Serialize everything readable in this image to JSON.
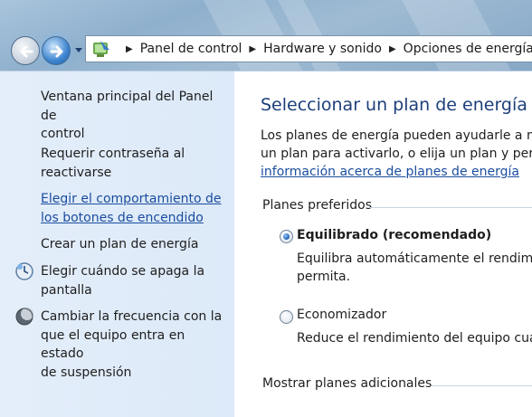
{
  "breadcrumb": [
    "Panel de control",
    "Hardware y sonido",
    "Opciones de energía"
  ],
  "icons": {
    "back": "back-arrow-icon",
    "forward": "forward-arrow-icon",
    "recent": "chevron-down-icon",
    "control_panel": "control-panel-icon",
    "display": "display-clock-icon",
    "sleep": "moon-sleep-icon"
  },
  "sidebar": {
    "items": [
      {
        "line1": "Ventana principal del Panel de",
        "line2": "control"
      },
      {
        "line1": "Requerir contraseña al",
        "line2": "reactivarse"
      },
      {
        "line1": "Elegir el comportamiento de",
        "line2": "los botones de encendido"
      },
      {
        "line1": "Crear un plan de energía"
      },
      {
        "line1": "Elegir cuándo se apaga la",
        "line2": "pantalla"
      },
      {
        "line1": "Cambiar la frecuencia con la",
        "line2": "que el equipo entra en estado",
        "line3": "de suspensión"
      }
    ]
  },
  "main": {
    "title": "Seleccionar un plan de energía",
    "desc_line1": "Los planes de energía pueden ayudarle a max",
    "desc_line2": "un plan para activarlo, o elija un plan y perso",
    "desc_link": "información acerca de planes de energía",
    "preferred_label": "Planes preferidos",
    "plans": [
      {
        "name": "Equilibrado (recomendado)",
        "selected": true,
        "desc_line1": "Equilibra automáticamente el rendimien",
        "desc_line2": "permita."
      },
      {
        "name": "Economizador",
        "selected": false,
        "desc_line1": "Reduce el rendimiento del equipo cuan"
      }
    ],
    "more_label": "Mostrar planes adicionales"
  },
  "colors": {
    "link": "#1a4d9e",
    "title": "#1d3f7a",
    "sidebar_bg": "#dce9f8"
  }
}
